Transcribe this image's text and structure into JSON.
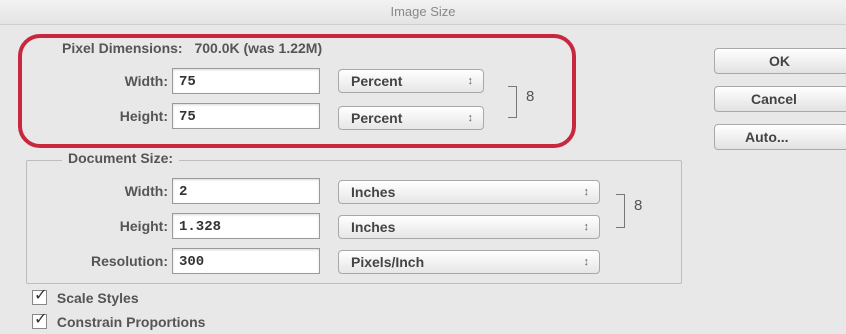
{
  "window": {
    "title": "Image Size"
  },
  "pixel_dimensions": {
    "legend": "Pixel Dimensions:",
    "size_text": "700.0K (was 1.22M)",
    "width_label": "Width:",
    "width_value": "75",
    "width_unit": "Percent",
    "height_label": "Height:",
    "height_value": "75",
    "height_unit": "Percent"
  },
  "document_size": {
    "legend": "Document Size:",
    "width_label": "Width:",
    "width_value": "2",
    "width_unit": "Inches",
    "height_label": "Height:",
    "height_value": "1.328",
    "height_unit": "Inches",
    "resolution_label": "Resolution:",
    "resolution_value": "300",
    "resolution_unit": "Pixels/Inch"
  },
  "buttons": {
    "ok": "OK",
    "cancel": "Cancel",
    "auto": "Auto..."
  },
  "options": {
    "scale_styles": "Scale Styles",
    "constrain_proportions": "Constrain Proportions"
  },
  "select_arrow_small": "↕",
  "select_arrow": "↕",
  "chain_glyph": "8",
  "check_glyph": "✓",
  "colors": {
    "highlight": "#c8283f",
    "background": "#e8e8e8"
  }
}
